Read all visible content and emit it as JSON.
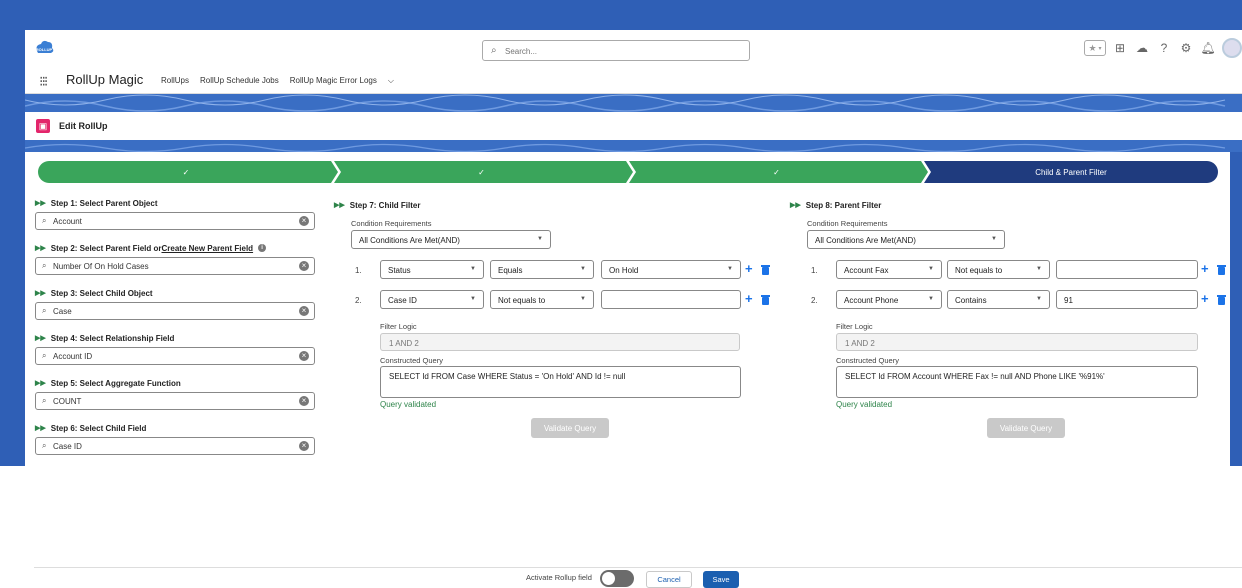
{
  "header": {
    "logo_text": "ROLLUP",
    "search_placeholder": "Search...",
    "icons": [
      "star-icon",
      "chevron-down-icon",
      "add-icon",
      "cloud-help-icon",
      "question-icon",
      "gear-icon",
      "bell-icon",
      "avatar"
    ]
  },
  "nav": {
    "app_name": "RollUp Magic",
    "items": [
      "RollUps",
      "RollUp Schedule Jobs",
      "RollUp Magic Error Logs"
    ],
    "more_icon": "chevron-down-icon"
  },
  "page": {
    "title": "Edit RollUp",
    "icon": "rollup-object-icon",
    "icon_color": "#e3256b"
  },
  "path": {
    "stages": [
      {
        "label": "✓",
        "state": "complete"
      },
      {
        "label": "✓",
        "state": "complete"
      },
      {
        "label": "✓",
        "state": "complete"
      },
      {
        "label": "Child & Parent Filter",
        "state": "current"
      }
    ],
    "complete_color": "#3aa55b",
    "current_color": "#1f3b7e"
  },
  "steps": [
    {
      "label": "Step 1: Select Parent Object",
      "value": "Account"
    },
    {
      "label_prefix": "Step 2: Select Parent Field or ",
      "label_link": "Create New Parent Field",
      "value": "Number Of On Hold Cases"
    },
    {
      "label": "Step 3: Select Child Object",
      "value": "Case"
    },
    {
      "label": "Step 4: Select Relationship Field",
      "value": "Account ID"
    },
    {
      "label": "Step 5: Select Aggregate Function",
      "value": "COUNT"
    },
    {
      "label": "Step 6: Select Child Field",
      "value": "Case ID"
    }
  ],
  "child_filter": {
    "title": "Step 7: Child Filter",
    "condition_label": "Condition Requirements",
    "condition_value": "All Conditions Are Met(AND)",
    "rows": [
      {
        "num": "1.",
        "field": "Status",
        "operator": "Equals",
        "value": "On Hold",
        "value_is_picklist": true
      },
      {
        "num": "2.",
        "field": "Case ID",
        "operator": "Not equals to",
        "value": "",
        "value_is_picklist": false
      }
    ],
    "filter_logic_label": "Filter Logic",
    "filter_logic": "1 AND 2",
    "query_label": "Constructed Query",
    "query": "SELECT Id FROM Case WHERE Status = 'On Hold'  AND  Id != null",
    "validated": "Query validated",
    "validate_button": "Validate Query"
  },
  "parent_filter": {
    "title": "Step 8: Parent Filter",
    "condition_label": "Condition Requirements",
    "condition_value": "All Conditions Are Met(AND)",
    "rows": [
      {
        "num": "1.",
        "field": "Account Fax",
        "operator": "Not equals to",
        "value": ""
      },
      {
        "num": "2.",
        "field": "Account Phone",
        "operator": "Contains",
        "value": "91"
      }
    ],
    "filter_logic_label": "Filter Logic",
    "filter_logic": "1 AND 2",
    "query_label": "Constructed Query",
    "query": "SELECT Id FROM Account WHERE Fax != null  AND  Phone LIKE '%91%'",
    "validated": "Query validated",
    "validate_button": "Validate Query"
  },
  "footer": {
    "activate_label": "Activate Rollup field",
    "toggle_on": false,
    "cancel": "Cancel",
    "save": "Save"
  }
}
